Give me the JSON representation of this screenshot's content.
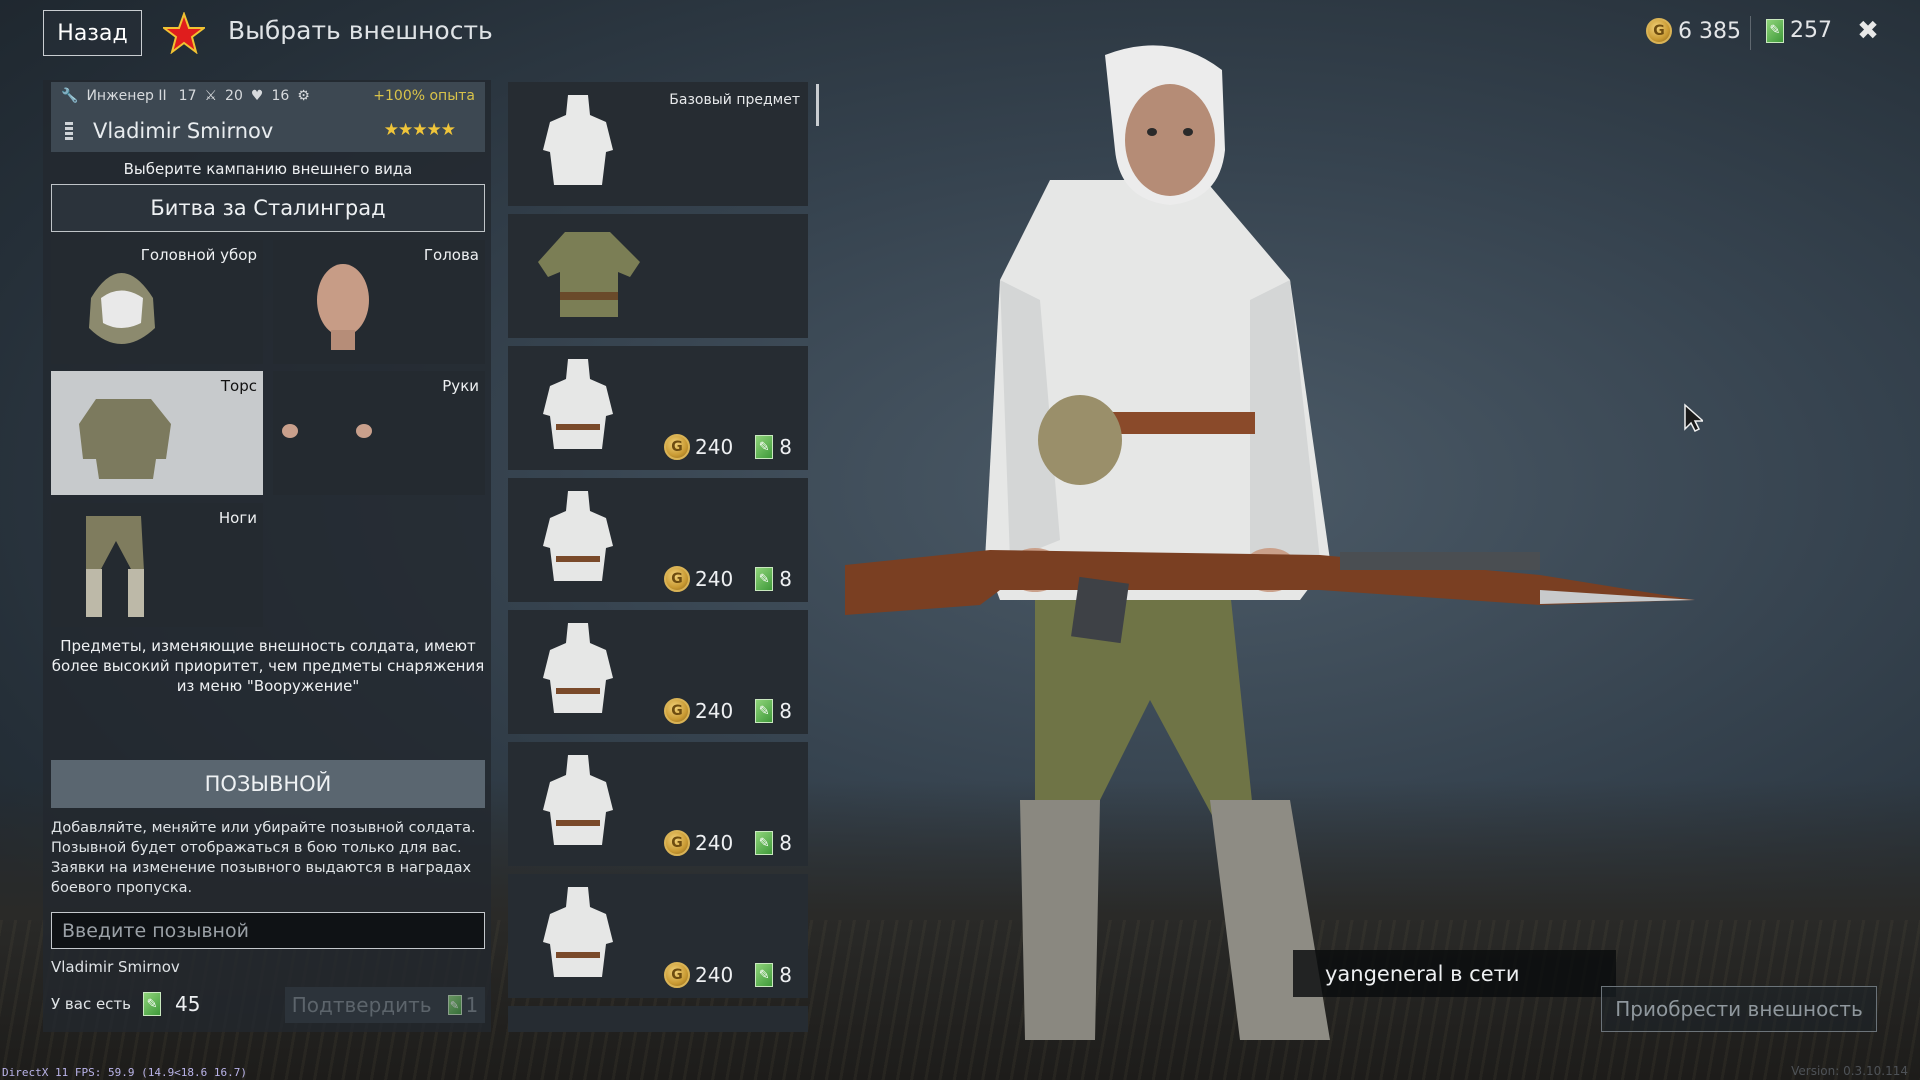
{
  "header": {
    "back_label": "Назад",
    "title": "Выбрать внешность",
    "gold_amount": "6 385",
    "tickets_amount": "257",
    "close_glyph": "✖",
    "star_color": "#e01d1d"
  },
  "soldier": {
    "class_label": "Инженер II",
    "stat1": "17",
    "stat2": "20",
    "stat3": "16",
    "bonus": "+100% опыта",
    "name": "Vladimir Smirnov",
    "stars": "★★★★★"
  },
  "campaign": {
    "label": "Выберите кампанию внешнего вида",
    "value": "Битва за Сталинград"
  },
  "slots": {
    "headgear": "Головной убор",
    "head": "Голова",
    "torso": "Торс",
    "hands": "Руки",
    "legs": "Ноги"
  },
  "note": "Предметы, изменяющие внешность солдата, имеют более высокий приоритет, чем предметы снаряжения из меню \"Вооружение\"",
  "callsign": {
    "header": "ПОЗЫВНОЙ",
    "description": "Добавляйте, меняйте или убирайте позывной солдата. Позывной будет отображаться в бою только для вас. Заявки на изменение позывного выдаются в наградах боевого пропуска.",
    "placeholder": "Введите позывной",
    "current": "Vladimir Smirnov",
    "have_label": "У вас есть",
    "have_amount": "45",
    "confirm_label": "Подтвердить",
    "confirm_cost": "1"
  },
  "items": {
    "base_label": "Базовый предмет",
    "list": [
      {
        "kind": "base"
      },
      {
        "kind": "owned"
      },
      {
        "gold": "240",
        "tickets": "8"
      },
      {
        "gold": "240",
        "tickets": "8"
      },
      {
        "gold": "240",
        "tickets": "8"
      },
      {
        "gold": "240",
        "tickets": "8"
      },
      {
        "gold": "240",
        "tickets": "8"
      }
    ]
  },
  "toast": "yangeneral в сети",
  "buy_label": "Приобрести внешность",
  "fps": "DirectX 11 FPS: 59.9 (14.9<18.6 16.7)",
  "version": "Version: 0.3.10.114",
  "icons": {
    "coin": "gold-coin-icon",
    "ticket": "ticket-icon",
    "star": "red-star-icon",
    "close": "close-icon"
  }
}
